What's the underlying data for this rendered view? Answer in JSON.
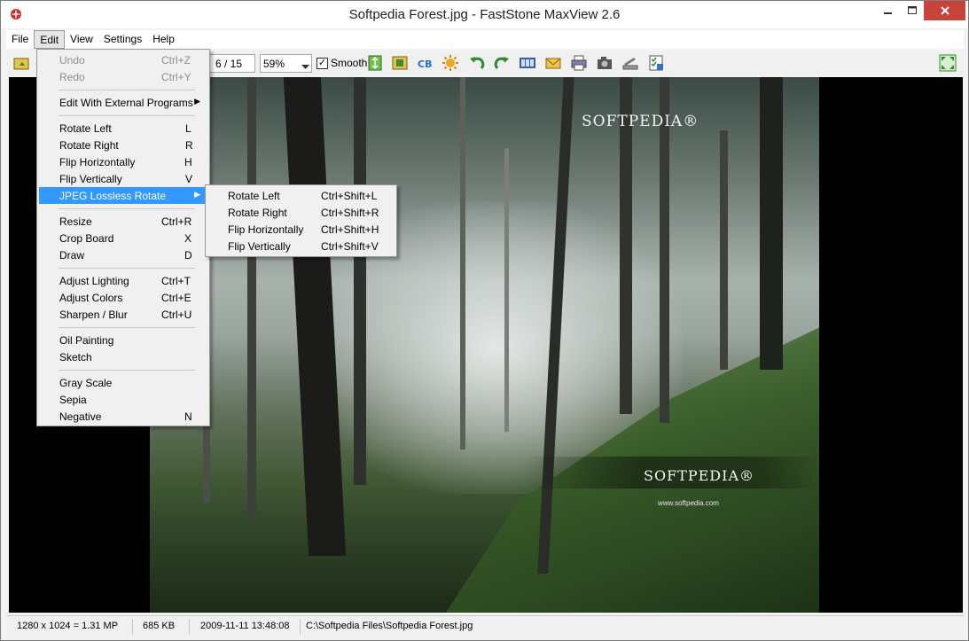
{
  "window": {
    "title": "Softpedia Forest.jpg - FastStone MaxView 2.6"
  },
  "menubar": {
    "items": [
      "File",
      "Edit",
      "View",
      "Settings",
      "Help"
    ]
  },
  "toolbar": {
    "page": "6 / 15",
    "zoom": "59%",
    "smooth_label": "Smooth",
    "smooth_checked": true
  },
  "edit_menu": {
    "items": [
      {
        "label": "Undo",
        "shortcut": "Ctrl+Z",
        "disabled": true
      },
      {
        "label": "Redo",
        "shortcut": "Ctrl+Y",
        "disabled": true
      },
      {
        "label": "Edit With External Programs",
        "submenu": true
      },
      {
        "label": "Rotate Left",
        "shortcut": "L"
      },
      {
        "label": "Rotate Right",
        "shortcut": "R"
      },
      {
        "label": "Flip Horizontally",
        "shortcut": "H"
      },
      {
        "label": "Flip Vertically",
        "shortcut": "V"
      },
      {
        "label": "JPEG Lossless Rotate",
        "submenu": true,
        "highlighted": true
      },
      {
        "label": "Resize",
        "shortcut": "Ctrl+R"
      },
      {
        "label": "Crop Board",
        "shortcut": "X"
      },
      {
        "label": "Draw",
        "shortcut": "D"
      },
      {
        "label": "Adjust Lighting",
        "shortcut": "Ctrl+T"
      },
      {
        "label": "Adjust Colors",
        "shortcut": "Ctrl+E"
      },
      {
        "label": "Sharpen / Blur",
        "shortcut": "Ctrl+U"
      },
      {
        "label": "Oil Painting"
      },
      {
        "label": "Sketch"
      },
      {
        "label": "Gray Scale"
      },
      {
        "label": "Sepia"
      },
      {
        "label": "Negative",
        "shortcut": "N"
      }
    ]
  },
  "jpeg_submenu": {
    "items": [
      {
        "label": "Rotate Left",
        "shortcut": "Ctrl+Shift+L"
      },
      {
        "label": "Rotate Right",
        "shortcut": "Ctrl+Shift+R"
      },
      {
        "label": "Flip Horizontally",
        "shortcut": "Ctrl+Shift+H"
      },
      {
        "label": "Flip Vertically",
        "shortcut": "Ctrl+Shift+V"
      }
    ]
  },
  "image": {
    "watermark_top": "SOFTPEDIA®",
    "watermark_bottom": "SOFTPEDIA®",
    "watermark_url": "www.softpedia.com"
  },
  "statusbar": {
    "dimensions": "1280 x 1024 = 1.31 MP",
    "filesize": "685 KB",
    "datetime": "2009-11-11 13:48:08",
    "path": "C:\\Softpedia Files\\Softpedia Forest.jpg"
  },
  "colors": {
    "highlight": "#3399ff",
    "close_button": "#c7443a"
  }
}
